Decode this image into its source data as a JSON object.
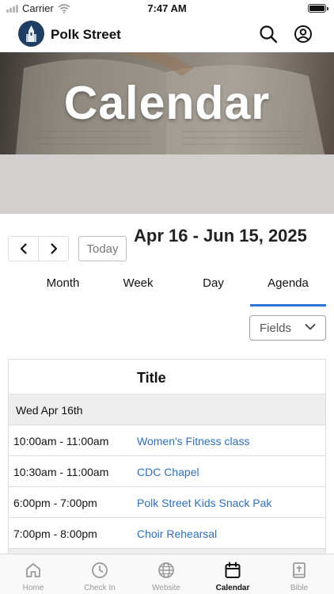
{
  "status_bar": {
    "carrier": "Carrier",
    "time": "7:47 AM"
  },
  "header": {
    "app_title": "Polk Street",
    "icons": [
      "search-icon",
      "account-icon"
    ]
  },
  "hero": {
    "title": "Calendar"
  },
  "controls": {
    "prev_icon": "chevron-left-icon",
    "next_icon": "chevron-right-icon",
    "today_label": "Today",
    "date_range": "Apr 16 - Jun 15, 2025"
  },
  "view_tabs": [
    {
      "label": "Month"
    },
    {
      "label": "Week"
    },
    {
      "label": "Day"
    },
    {
      "label": "Agenda",
      "active": true
    }
  ],
  "fields": {
    "label": "Fields"
  },
  "agenda": {
    "column_title": "Title",
    "day_label": "Wed Apr 16th",
    "events": [
      {
        "time": "10:00am - 11:00am",
        "title": "Women's Fitness class"
      },
      {
        "time": "10:30am - 11:00am",
        "title": "CDC Chapel"
      },
      {
        "time": "6:00pm - 7:00pm",
        "title": "Polk Street Kids Snack Pak"
      },
      {
        "time": "7:00pm - 8:00pm",
        "title": "Choir Rehearsal"
      }
    ]
  },
  "tabbar": [
    {
      "label": "Home",
      "icon": "home-icon"
    },
    {
      "label": "Check In",
      "icon": "clock-icon"
    },
    {
      "label": "Website",
      "icon": "globe-icon"
    },
    {
      "label": "Calendar",
      "icon": "calendar-icon",
      "active": true
    },
    {
      "label": "Bible",
      "icon": "bible-icon"
    }
  ],
  "colors": {
    "accent": "#2e74d6",
    "link": "#2f6fb8",
    "logo_bg": "#1e3e64"
  }
}
